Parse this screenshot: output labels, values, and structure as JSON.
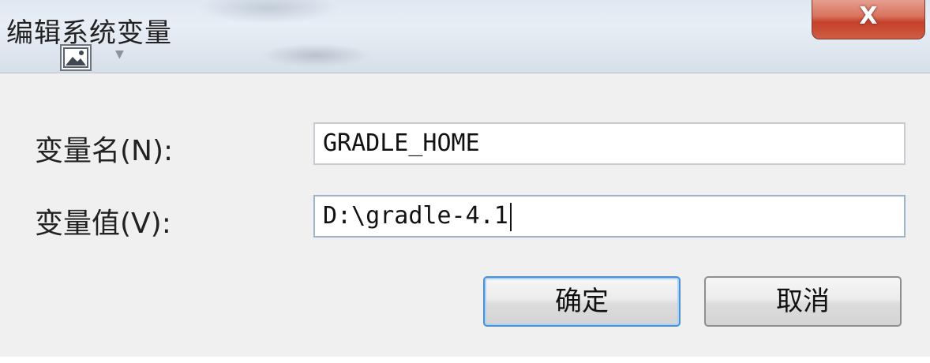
{
  "window": {
    "title": "编辑系统变量",
    "close_glyph": "X"
  },
  "toolbar": {
    "picture_icon": "picture-icon",
    "dropdown_glyph": "▼"
  },
  "form": {
    "name_label": "变量名(N):",
    "name_value": "GRADLE_HOME",
    "value_label": "变量值(V):",
    "value_value": "D:\\gradle-4.1"
  },
  "buttons": {
    "ok_label": "确定",
    "cancel_label": "取消"
  },
  "colors": {
    "close_button": "#c5412a",
    "default_button_border": "#4f8fd4"
  }
}
